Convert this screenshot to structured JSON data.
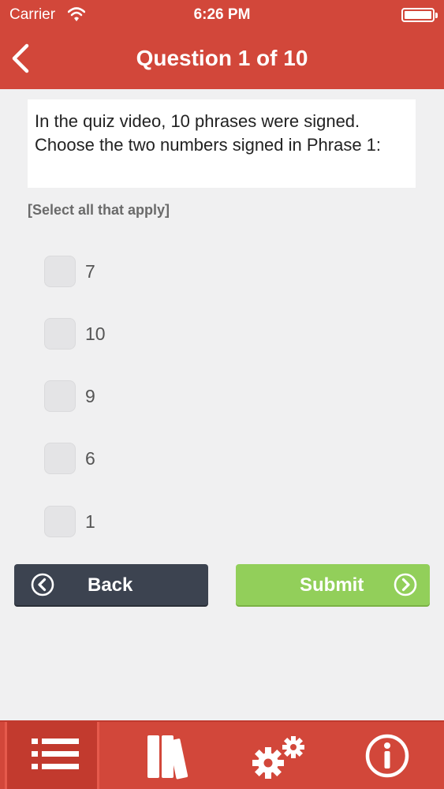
{
  "status": {
    "carrier": "Carrier",
    "time": "6:26 PM"
  },
  "nav": {
    "title": "Question 1 of 10"
  },
  "question": {
    "text": "In the quiz video, 10 phrases were signed. Choose the two numbers signed in Phrase 1:"
  },
  "hint": "[Select all that apply]",
  "options": [
    {
      "label": "7",
      "checked": false
    },
    {
      "label": "10",
      "checked": false
    },
    {
      "label": "9",
      "checked": false
    },
    {
      "label": "6",
      "checked": false
    },
    {
      "label": "1",
      "checked": false
    }
  ],
  "buttons": {
    "back_label": "Back",
    "submit_label": "Submit"
  },
  "tabs": [
    {
      "icon": "list-icon",
      "active": true
    },
    {
      "icon": "books-icon",
      "active": false
    },
    {
      "icon": "gears-icon",
      "active": false
    },
    {
      "icon": "info-icon",
      "active": false
    }
  ],
  "colors": {
    "header": "#d2473a",
    "submit": "#92cf5a",
    "back": "#3c4350"
  }
}
